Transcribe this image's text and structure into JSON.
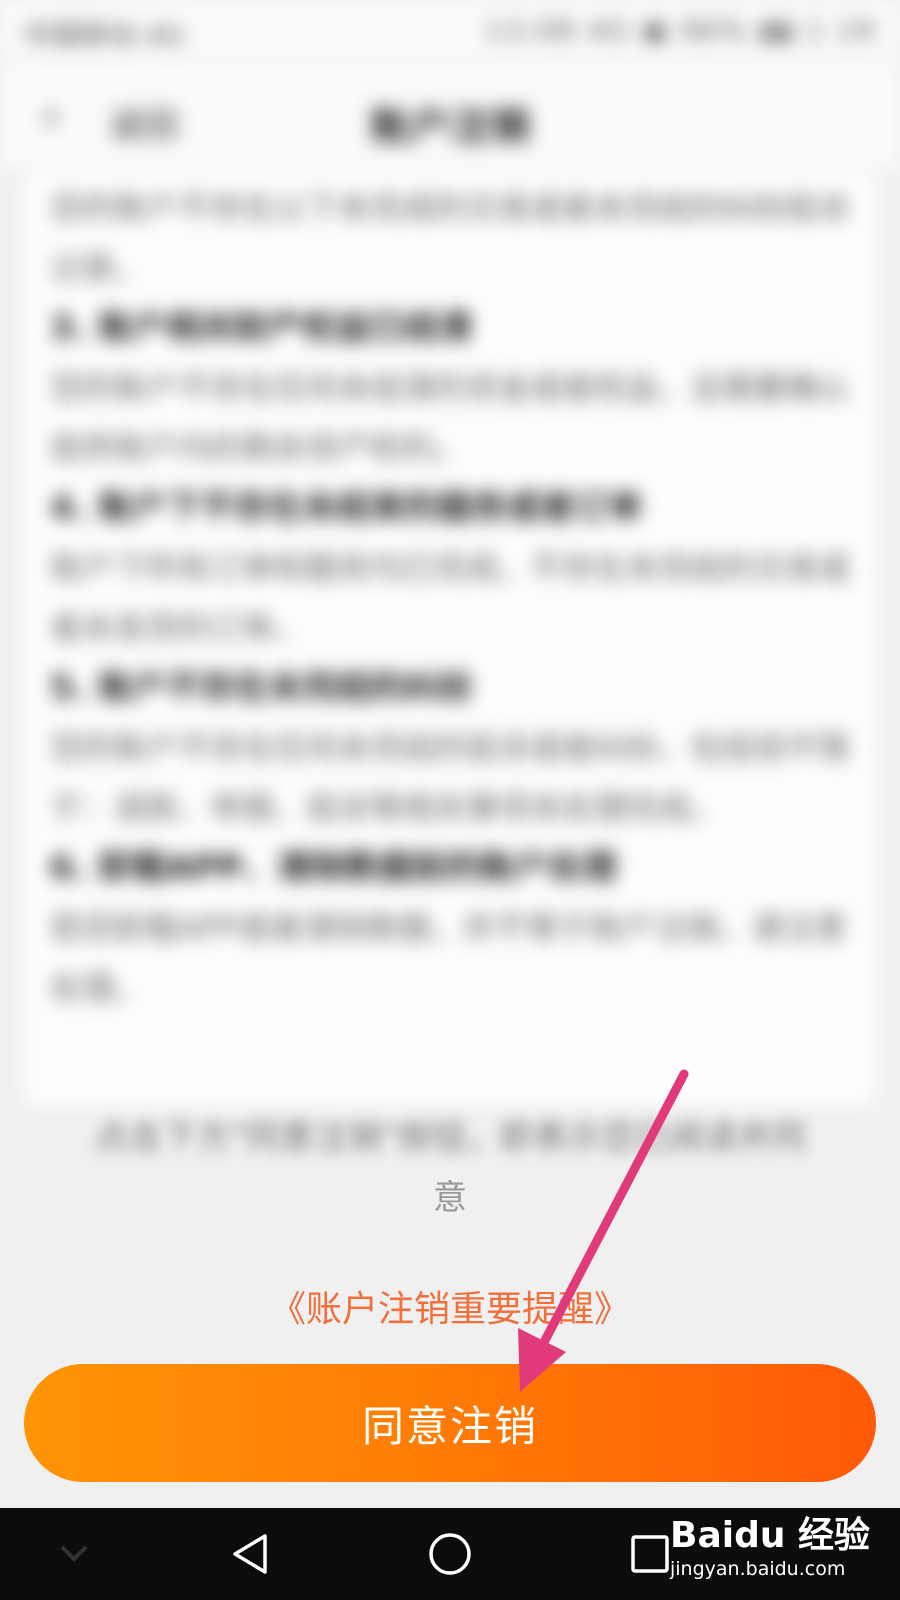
{
  "status_bar": {
    "carrier": "中国移动 4G",
    "right": "13:08  4G  ▣  96% ▮▮ 1 19"
  },
  "header": {
    "back_label": "返回",
    "title": "账户注销"
  },
  "content": {
    "blocks": [
      {
        "type": "text",
        "text": "您的账户不存在以下未完成的交易或者未完结的纠纷投诉记录。"
      },
      {
        "type": "heading",
        "text": "3. 账户相关财产权益已结清"
      },
      {
        "type": "text",
        "text": "您的账户不存在任何未结清的资金或者权益，且需要确认放弃账户内的剩余资产权利。"
      },
      {
        "type": "heading",
        "text": "4. 账户下不存在未结束的服务或者订单"
      },
      {
        "type": "text",
        "text": "账户下所有订单和服务均已完成，不存在未完结的交易或者未发货的订单。"
      },
      {
        "type": "heading",
        "text": "5. 账户不存在未完结的纠纷"
      },
      {
        "type": "text",
        "text": "您的账户不存在任何未完结的投诉或者纠纷，包括但不限于：退款、举报、投诉等相关事项未处理完成。"
      },
      {
        "type": "heading",
        "text": "6. 卸载APP、清除数据前的账户处理"
      },
      {
        "type": "text",
        "text": "若您卸载APP或者清除数据，并不等于账户注销，请注意处理。"
      }
    ]
  },
  "notice": {
    "lead": "点击下方\"同意注销\"按钮，即表示您已阅读并同",
    "last": "意"
  },
  "reminder_link": "《账户注销重要提醒》",
  "agree_button": "同意注销",
  "watermark": {
    "brand": "Baidu 经验",
    "url": "jingyan.baidu.com"
  },
  "icons": {
    "back": "chevron-left-icon",
    "nav_back": "triangle-back-icon",
    "nav_home": "circle-home-icon",
    "nav_recents": "square-recents-icon",
    "nav_hide": "chevron-down-icon",
    "arrow": "arrow-annotation"
  },
  "colors": {
    "accent_start": "#ff9406",
    "accent_end": "#ff5a08",
    "link": "#f06f3b",
    "arrow": "#e03a7a"
  }
}
